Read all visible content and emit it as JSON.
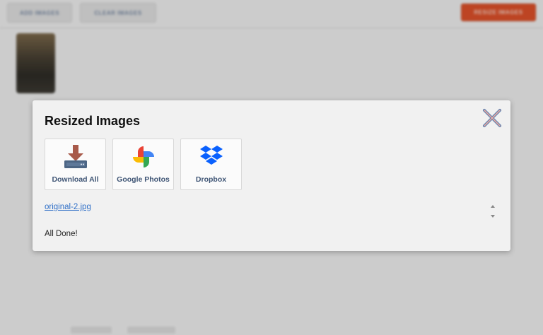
{
  "background": {
    "add_button": "ADD IMAGES",
    "clear_button": "CLEAR IMAGES",
    "resize_button": "RESIZE IMAGES"
  },
  "modal": {
    "title": "Resized Images",
    "actions": [
      {
        "label": "Download All",
        "icon": "download-icon"
      },
      {
        "label": "Google Photos",
        "icon": "google-photos-icon"
      },
      {
        "label": "Dropbox",
        "icon": "dropbox-icon"
      }
    ],
    "file_name": "original-2.jpg",
    "status": "All Done!"
  },
  "colors": {
    "accent": "#e2522a",
    "link": "#2f6fc7",
    "tile_label": "#3f5575"
  }
}
